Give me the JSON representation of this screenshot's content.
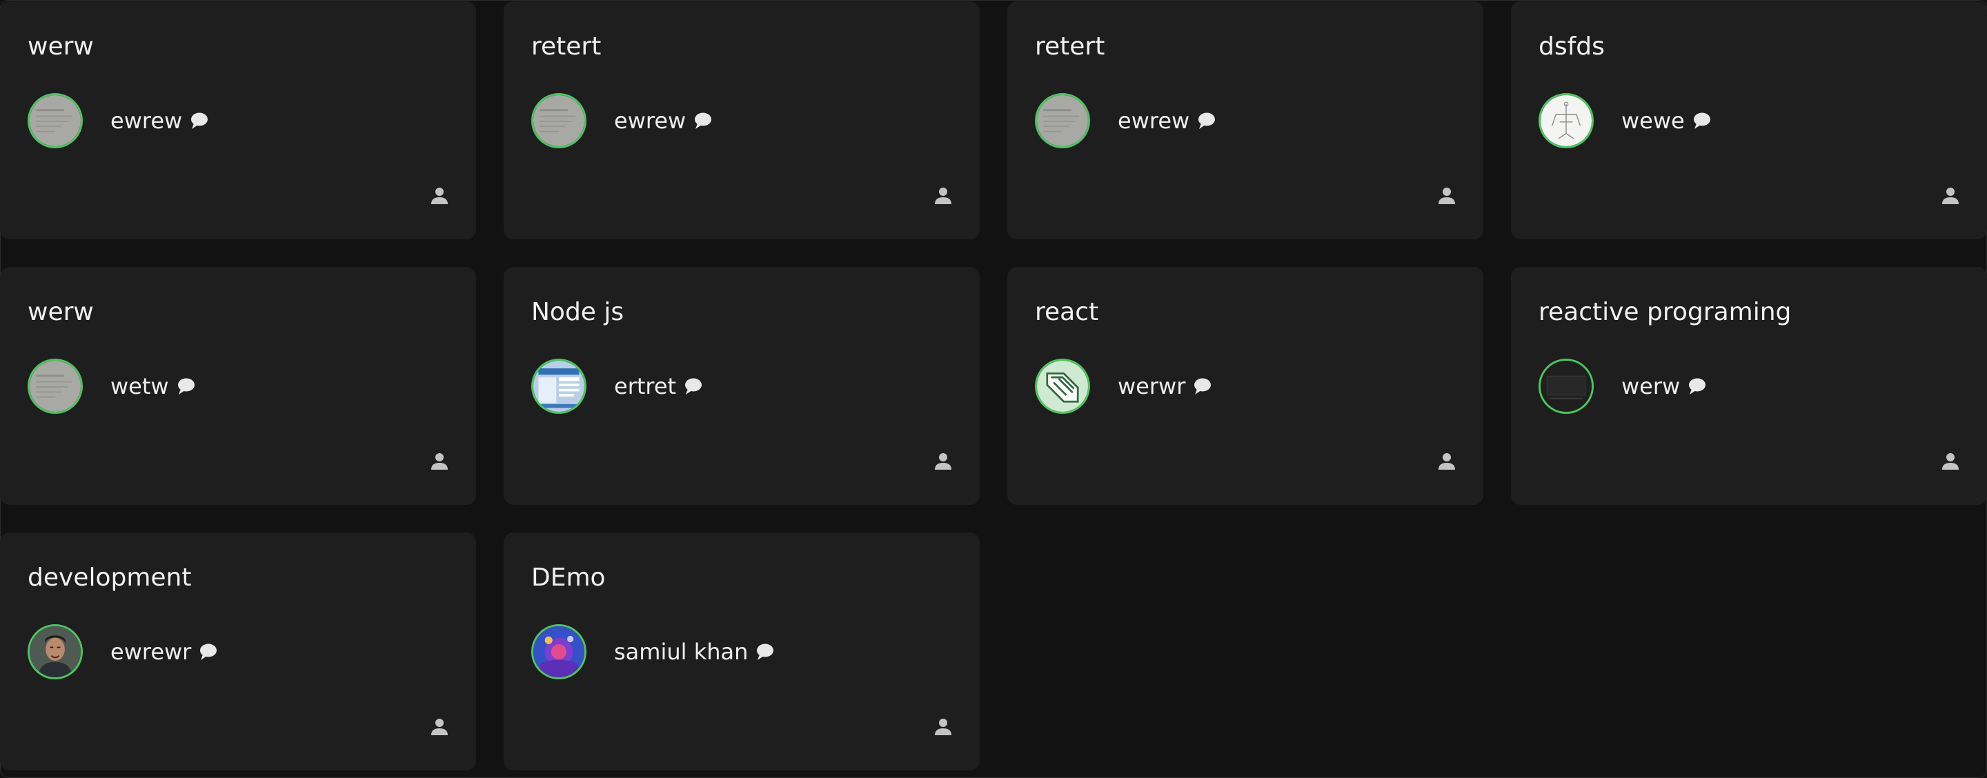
{
  "cards": [
    {
      "title": "werw",
      "owner": "ewrew",
      "avatar": "paper-sketch"
    },
    {
      "title": "retert",
      "owner": "ewrew",
      "avatar": "paper-sketch"
    },
    {
      "title": "retert",
      "owner": "ewrew",
      "avatar": "paper-sketch"
    },
    {
      "title": "dsfds",
      "owner": "wewe",
      "avatar": "white-diagram"
    },
    {
      "title": "werw",
      "owner": "wetw",
      "avatar": "paper-sketch"
    },
    {
      "title": "Node js",
      "owner": "ertret",
      "avatar": "blue-screenshot"
    },
    {
      "title": "react",
      "owner": "werwr",
      "avatar": "green-logo"
    },
    {
      "title": "reactive programing",
      "owner": "werw",
      "avatar": "dark-screen"
    },
    {
      "title": "development",
      "owner": "ewrewr",
      "avatar": "portrait"
    },
    {
      "title": "DEmo",
      "owner": "samiul khan",
      "avatar": "colorful-art"
    }
  ],
  "icons": {
    "chat": "speech-bubble-icon",
    "member": "person-icon"
  },
  "colors": {
    "page_background": "#111111",
    "card_background": "#1e1e1e",
    "avatar_ring": "#4cc560",
    "text": "#f0f0f0"
  }
}
